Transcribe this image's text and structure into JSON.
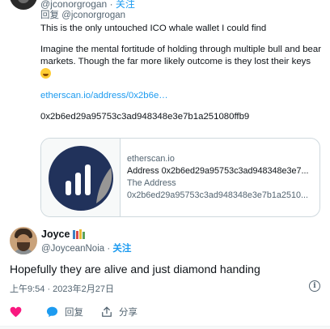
{
  "quoted_tweet": {
    "handle_line": "@jconorgrogan",
    "follow_label": "关注",
    "reply_prefix": "回复",
    "reply_handle": "@jconorgrogan",
    "lines": [
      "This is the only untouched ICO whale wallet I could find",
      "Imagine the mental fortitude of holding through multiple bull and bear markets. Though the far more likely outcome is they lost their keys",
      "etherscan.io/address/0x2b6e…",
      "0x2b6ed29a95753c3ad948348e3e7b1a251080ffb9"
    ],
    "card": {
      "domain": "etherscan.io",
      "title": "Address 0x2b6ed29a95753c3ad948348e3e7...",
      "subtitle": "The Address",
      "description": "0x2b6ed29a95753c3ad948348e3e7b1a2510..."
    }
  },
  "reply": {
    "name": "Joyce",
    "handle": "@JoyceanNoia",
    "separator": "·",
    "follow_label": "关注",
    "text": "Hopefully they are alive and just diamond handing",
    "timestamp": "上午9:54 · 2023年2月27日",
    "actions": {
      "like_icon": "heart-icon",
      "reply_label": "回复",
      "reply_icon": "comment-icon",
      "share_label": "分享",
      "share_icon": "share-icon"
    }
  },
  "colors": {
    "accent": "#1d9bf0",
    "like": "#f91880",
    "text": "#0f1419",
    "muted": "#536471",
    "border": "#cfd9de"
  }
}
